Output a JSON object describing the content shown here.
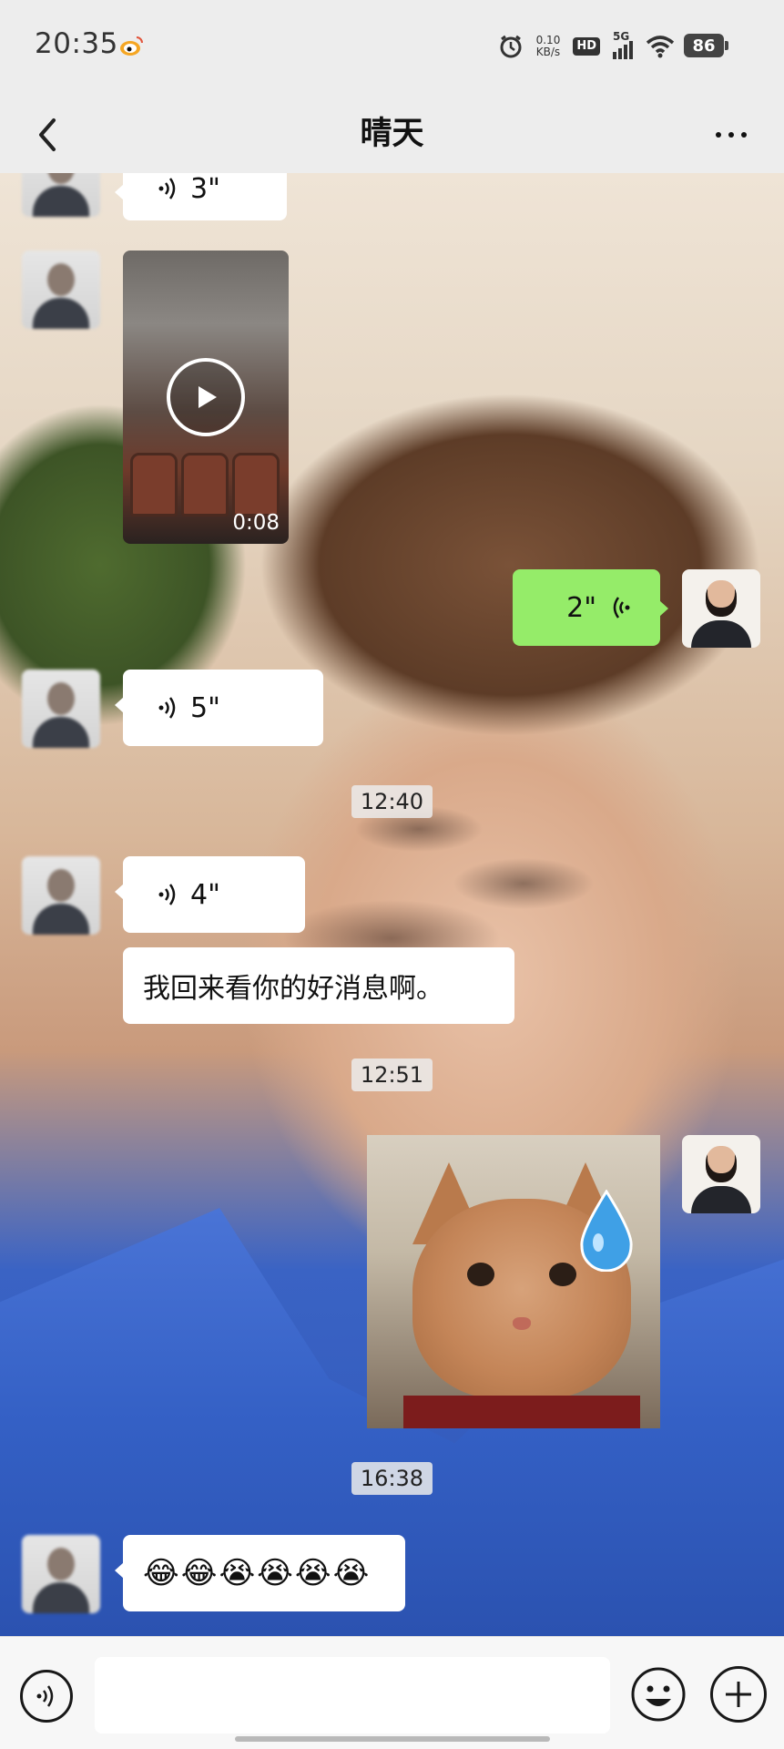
{
  "status_bar": {
    "time": "20:35",
    "net_speed_value": "0.10",
    "net_speed_unit": "KB/s",
    "hd_label": "HD",
    "network_label": "5G",
    "battery_level": "86",
    "icons": [
      "weibo-icon",
      "alarm-icon",
      "signal-icon",
      "wifi-icon",
      "battery-icon"
    ]
  },
  "nav": {
    "title": "晴天",
    "back_icon": "chevron-left-icon",
    "more_icon": "more-icon"
  },
  "messages": [
    {
      "type": "voice",
      "side": "left",
      "duration": "3\""
    },
    {
      "type": "video",
      "side": "left",
      "duration": "0:08"
    },
    {
      "type": "voice",
      "side": "right",
      "duration": "2\""
    },
    {
      "type": "voice",
      "side": "left",
      "duration": "5\""
    },
    {
      "type": "timestamp",
      "text": "12:40"
    },
    {
      "type": "voice",
      "side": "left",
      "duration": "4\""
    },
    {
      "type": "text",
      "side": "left",
      "text": "我回来看你的好消息啊。"
    },
    {
      "type": "timestamp",
      "text": "12:51"
    },
    {
      "type": "sticker",
      "side": "right",
      "description_icon": "crying-cat-sticker"
    },
    {
      "type": "timestamp",
      "text": "16:38"
    },
    {
      "type": "text",
      "side": "left",
      "text": "😂😂😭😭😭😭"
    }
  ],
  "input_bar": {
    "placeholder": "",
    "voice_icon": "voice-toggle-icon",
    "emoji_icon": "emoji-icon",
    "plus_icon": "plus-icon"
  },
  "colors": {
    "app_bg": "#ededed",
    "bubble_self": "#95ec69",
    "bubble_other": "#ffffff"
  }
}
